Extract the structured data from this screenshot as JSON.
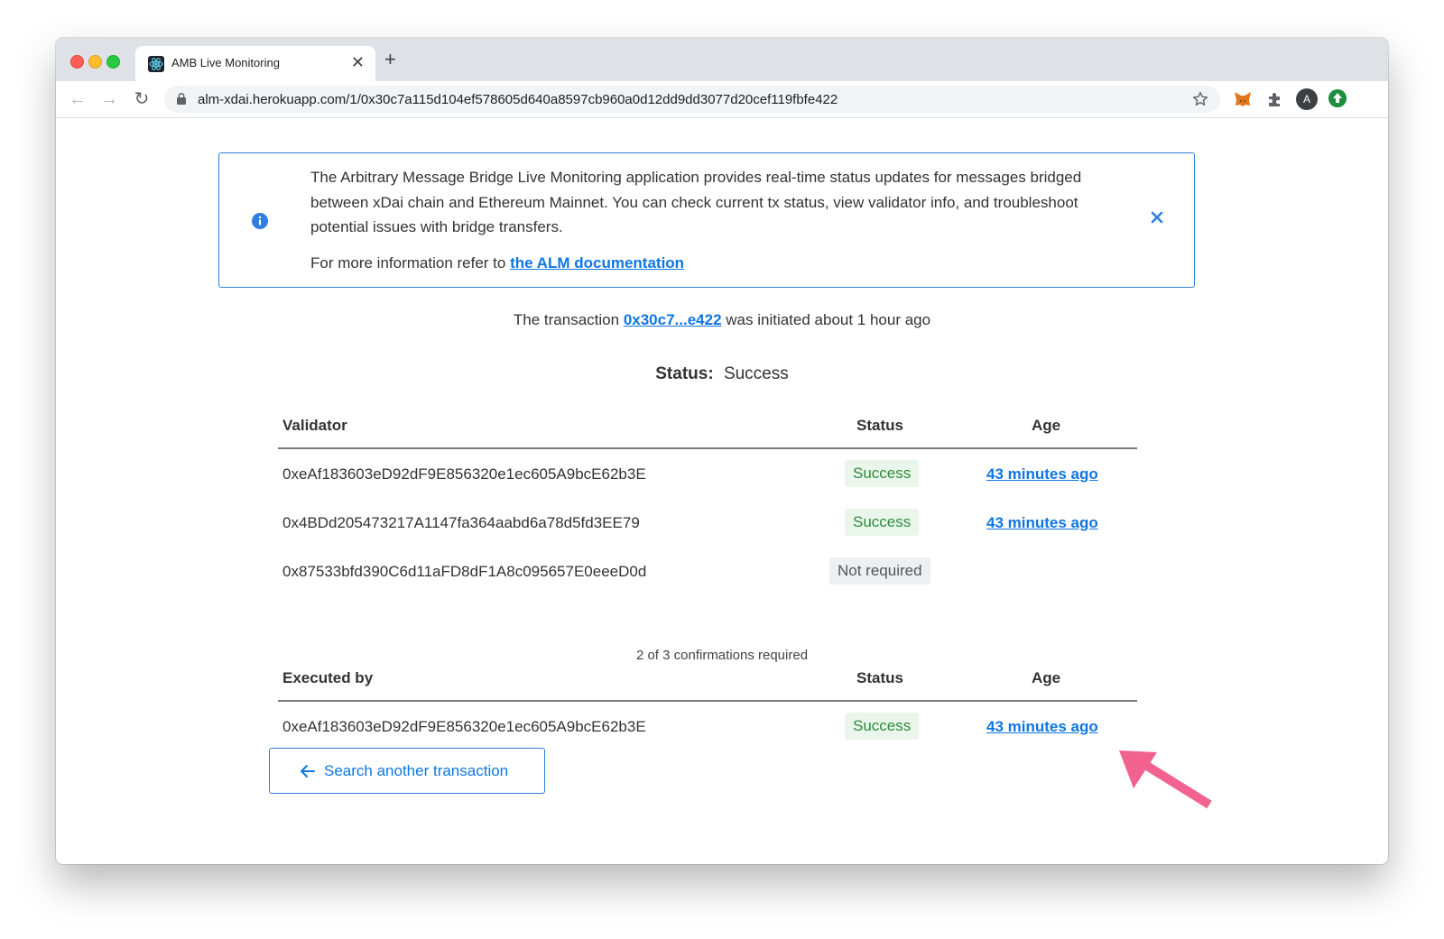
{
  "browser": {
    "tab_title": "AMB Live Monitoring",
    "url_host": "alm-xdai.herokuapp.com",
    "url_path": "/1/0x30c7a115d104ef578605d640a8597cb960a0d12dd9dd3077d20cef119fbfe422",
    "avatar_letter": "A"
  },
  "info": {
    "text": "The Arbitrary Message Bridge Live Monitoring application provides real-time status updates for messages bridged between xDai chain and Ethereum Mainnet. You can check current tx status, view validator info, and troubleshoot potential issues with bridge transfers.",
    "more_prefix": "For more information refer to",
    "doc_link": "the ALM documentation"
  },
  "transaction": {
    "prefix": "The transaction",
    "hash_short": "0x30c7...e422",
    "suffix": "was initiated about 1 hour ago"
  },
  "status": {
    "label": "Status:",
    "value": "Success"
  },
  "validators": {
    "headers": {
      "address": "Validator",
      "status": "Status",
      "age": "Age"
    },
    "rows": [
      {
        "address": "0xeAf183603eD92dF9E856320e1ec605A9bcE62b3E",
        "status": "Success",
        "age": "43 minutes ago"
      },
      {
        "address": "0x4BDd205473217A1147fa364aabd6a78d5fd3EE79",
        "status": "Success",
        "age": "43 minutes ago"
      },
      {
        "address": "0x87533bfd390C6d11aFD8dF1A8c095657E0eeeD0d",
        "status": "Not required",
        "age": ""
      }
    ],
    "confirmations": "2 of 3 confirmations required"
  },
  "executed": {
    "headers": {
      "address": "Executed by",
      "status": "Status",
      "age": "Age"
    },
    "rows": [
      {
        "address": "0xeAf183603eD92dF9E856320e1ec605A9bcE62b3E",
        "status": "Success",
        "age": "43 minutes ago"
      }
    ]
  },
  "search_button": "Search another transaction",
  "colors": {
    "accent": "#0e76e3",
    "success_bg": "#eaf6ec",
    "success_text": "#2f8a3c",
    "annotation_arrow": "#f2628f"
  }
}
